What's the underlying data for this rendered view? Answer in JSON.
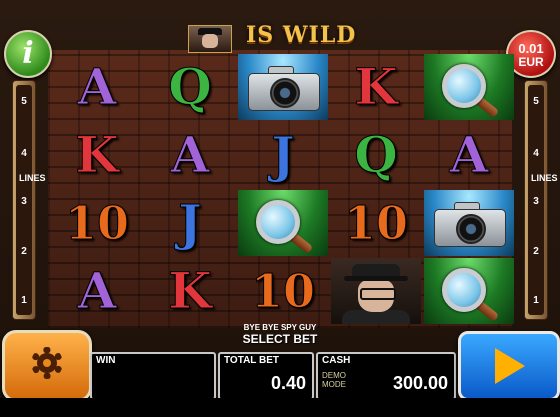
{
  "banner": {
    "text": "IS WILD",
    "icon": "gangster-face-icon"
  },
  "info_button": {
    "label": "i"
  },
  "bet_button": {
    "value": "0.01",
    "currency": "EUR"
  },
  "lines": {
    "word": "LINES",
    "numbers": [
      "5",
      "4",
      "3",
      "2",
      "1"
    ]
  },
  "reels": [
    [
      "A",
      "K",
      "10",
      "A"
    ],
    [
      "Q",
      "A",
      "J",
      "K"
    ],
    [
      "camera",
      "J",
      "magnifier",
      "10"
    ],
    [
      "K",
      "Q",
      "10",
      "boss"
    ],
    [
      "magnifier",
      "A",
      "camera",
      "magnifier"
    ]
  ],
  "game_name": "BYE BYE SPY GUY",
  "select_bet": "SELECT BET",
  "panels": {
    "win": {
      "label": "WIN",
      "value": ""
    },
    "total_bet": {
      "label": "TOTAL BET",
      "value": "0.40"
    },
    "cash": {
      "label": "CASH",
      "value": "300.00",
      "mode": "DEMO MODE"
    }
  },
  "icons": {
    "settings": "gear-icon",
    "spin": "play-arrow-icon"
  },
  "colors": {
    "spin": "#1a7ae8",
    "settings": "#f08a1a",
    "info": "#3aa02a",
    "bet": "#d01818"
  }
}
